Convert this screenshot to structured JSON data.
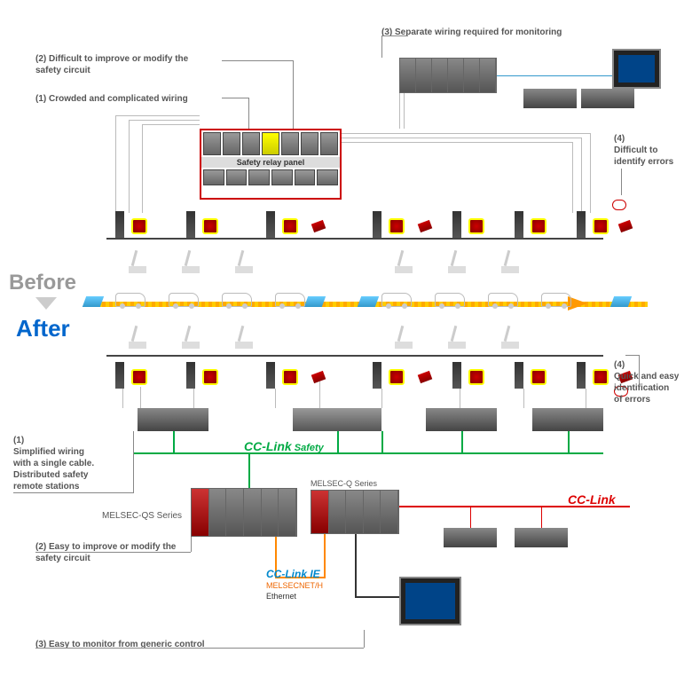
{
  "labels": {
    "before_1": "(1) Crowded and complicated wiring",
    "before_2": "(2) Difficult to improve or modify the\nsafety circuit",
    "before_3": "(3) Separate wiring required for monitoring",
    "before_4": "(4)\nDifficult to\nidentify errors",
    "after_1": "(1)\nSimplified wiring\nwith a single cable.\nDistributed safety\nremote stations",
    "after_2": "(2) Easy to improve or modify the\nsafety circuit",
    "after_3": "(3) Easy to monitor from generic control",
    "after_4": "(4)\nQuick and easy\nidentification\nof errors"
  },
  "titles": {
    "before": "Before",
    "after": "After"
  },
  "components": {
    "relay_panel": "Safety relay panel",
    "melsec_qs": "MELSEC-QS Series",
    "melsec_q": "MELSEC-Q Series"
  },
  "networks": {
    "cc_safety": "CC-Link Safety",
    "cc_link": "CC-Link",
    "cc_ie": "CC-Link IE",
    "melsecnet": "MELSECNET/H",
    "ethernet": "Ethernet"
  },
  "colors": {
    "safety_green": "#0a4",
    "cclink_red": "#d00",
    "ccie_orange": "#f80",
    "after_blue": "#0066cc"
  }
}
